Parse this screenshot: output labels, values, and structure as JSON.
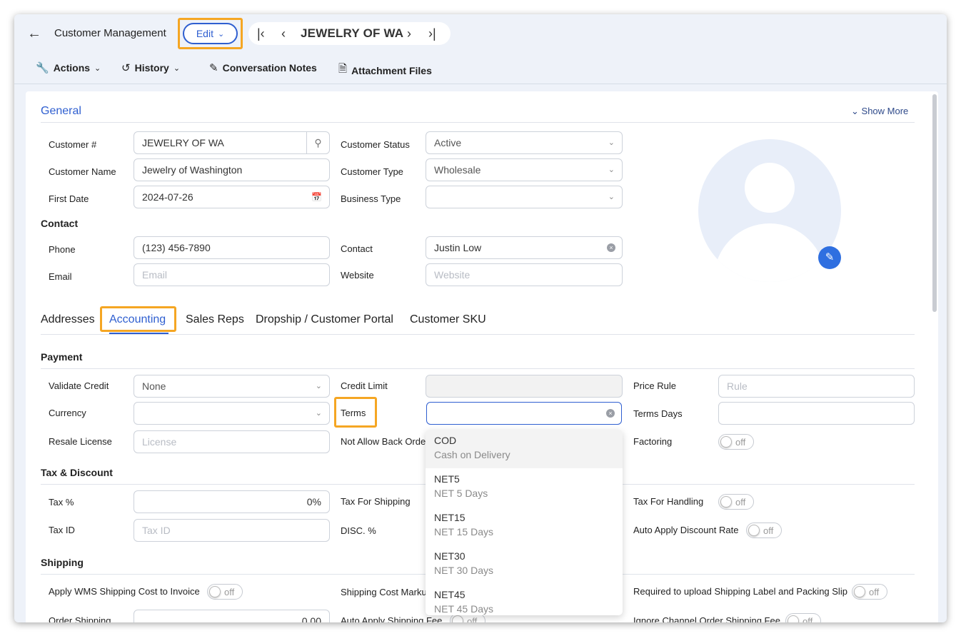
{
  "header": {
    "app_title": "Customer Management",
    "edit_label": "Edit",
    "record_title": "JEWELRY OF WA"
  },
  "toolbar": {
    "actions": "Actions",
    "history": "History",
    "notes": "Conversation Notes",
    "attachments": "Attachment Files"
  },
  "general": {
    "title": "General",
    "show_more": "Show More",
    "customer_no_label": "Customer #",
    "customer_no": "JEWELRY OF WA",
    "customer_name_label": "Customer Name",
    "customer_name": "Jewelry of Washington",
    "first_date_label": "First Date",
    "first_date": "2024-07-26",
    "status_label": "Customer Status",
    "status": "Active",
    "type_label": "Customer Type",
    "type": "Wholesale",
    "business_type_label": "Business Type",
    "business_type": ""
  },
  "contact": {
    "title": "Contact",
    "phone_label": "Phone",
    "phone": "(123) 456-7890",
    "email_label": "Email",
    "email_placeholder": "Email",
    "contact_label": "Contact",
    "contact": "Justin Low",
    "website_label": "Website",
    "website_placeholder": "Website"
  },
  "tabs": [
    "Addresses",
    "Accounting",
    "Sales Reps",
    "Dropship / Customer Portal",
    "Customer SKU"
  ],
  "payment": {
    "title": "Payment",
    "validate_credit_label": "Validate Credit",
    "validate_credit": "None",
    "currency_label": "Currency",
    "resale_license_label": "Resale License",
    "resale_license_placeholder": "License",
    "credit_limit_label": "Credit Limit",
    "terms_label": "Terms",
    "not_allow_back_order_label": "Not Allow Back Orde",
    "price_rule_label": "Price Rule",
    "price_rule_placeholder": "Rule",
    "terms_days_label": "Terms Days",
    "factoring_label": "Factoring"
  },
  "tax": {
    "title": "Tax & Discount",
    "tax_pct_label": "Tax %",
    "tax_pct": "0%",
    "tax_id_label": "Tax ID",
    "tax_id_placeholder": "Tax ID",
    "tax_shipping_label": "Tax For Shipping",
    "disc_label": "DISC. %",
    "tax_handling_label": "Tax For Handling",
    "auto_discount_label": "Auto Apply Discount Rate"
  },
  "shipping": {
    "title": "Shipping",
    "apply_wms_label": "Apply WMS Shipping Cost to Invoice",
    "markup_label": "Shipping Cost Marku",
    "required_upload_label": "Required to upload Shipping Label and Packing Slip",
    "order_shipping_label": "Order Shipping",
    "order_shipping": "0.00",
    "auto_apply_fee_label": "Auto Apply Shipping Fee",
    "ignore_channel_label": "Ignore Channel Order Shipping Fee"
  },
  "toggle_off": "off",
  "terms_dropdown": [
    {
      "code": "COD",
      "desc": "Cash on Delivery"
    },
    {
      "code": "NET5",
      "desc": "NET 5 Days"
    },
    {
      "code": "NET15",
      "desc": "NET 15 Days"
    },
    {
      "code": "NET30",
      "desc": "NET 30 Days"
    },
    {
      "code": "NET45",
      "desc": "NET 45 Days"
    }
  ],
  "colors": {
    "accent": "#2f5fd0",
    "highlight": "#f5a623",
    "background": "#eef2f9"
  }
}
